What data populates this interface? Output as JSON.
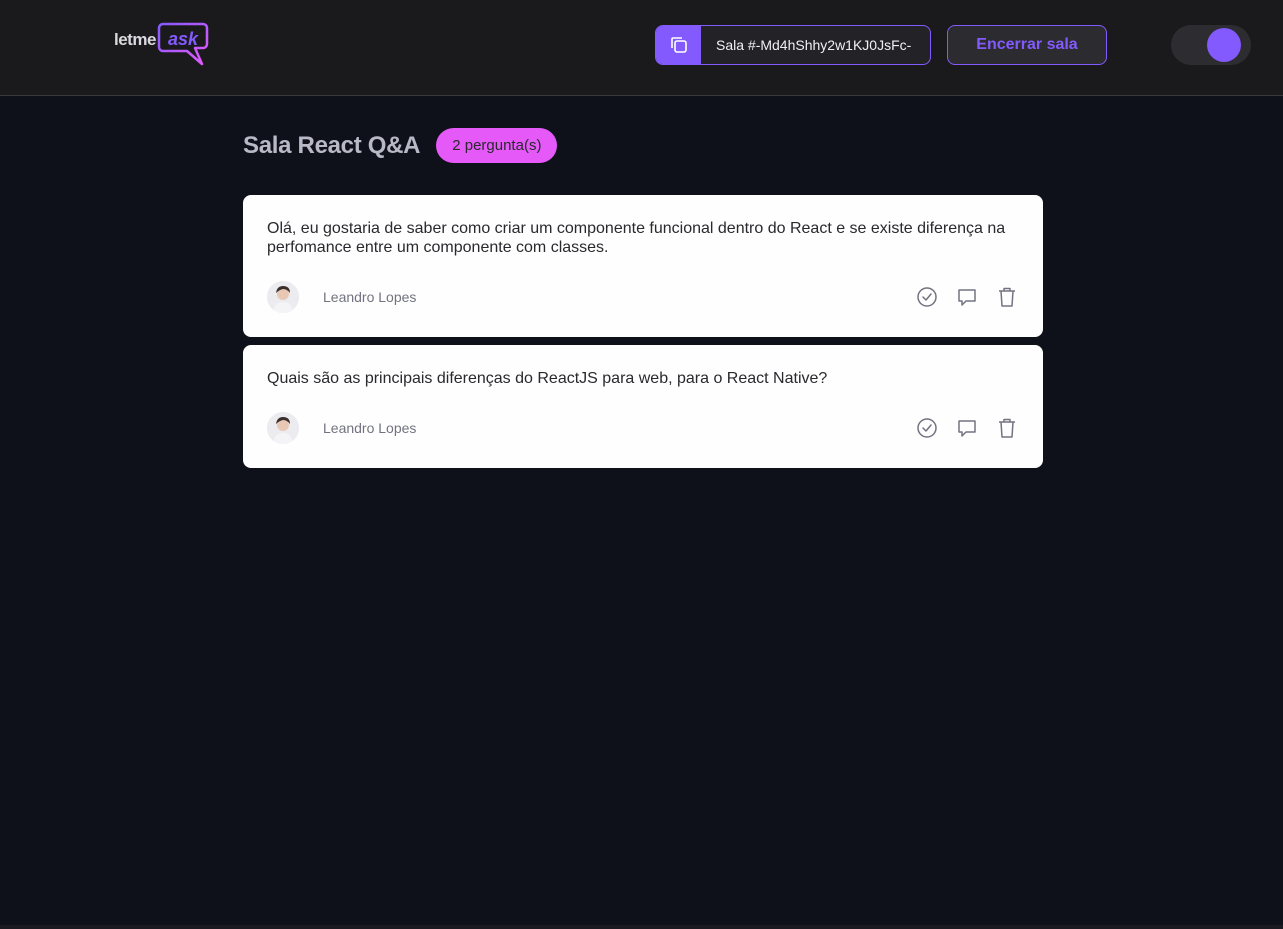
{
  "header": {
    "logo": {
      "prefix": "letme",
      "accent": "ask"
    },
    "room_code": {
      "text": "Sala #-Md4hShhy2w1KJ0JsFc-"
    },
    "end_room_label": "Encerrar sala",
    "theme_toggle": {
      "state": "dark"
    }
  },
  "main": {
    "title": "Sala React Q&A",
    "question_count": "2 pergunta(s)",
    "questions": [
      {
        "content": "Olá, eu gostaria de saber como criar um componente funcional dentro do React e se existe diferença na perfomance entre um componente com classes.",
        "author": "Leandro Lopes"
      },
      {
        "content": "Quais são as principais diferenças do ReactJS para web, para o React Native?",
        "author": "Leandro Lopes"
      }
    ]
  },
  "colors": {
    "accent": "#835afd",
    "badge": "#e559f9",
    "background": "#0f111a",
    "header": "#1a1a1c",
    "card": "#fefefe"
  },
  "icons": {
    "copy": "copy-icon",
    "check": "check-circle-icon",
    "answer": "chat-bubble-icon",
    "delete": "trash-icon"
  }
}
